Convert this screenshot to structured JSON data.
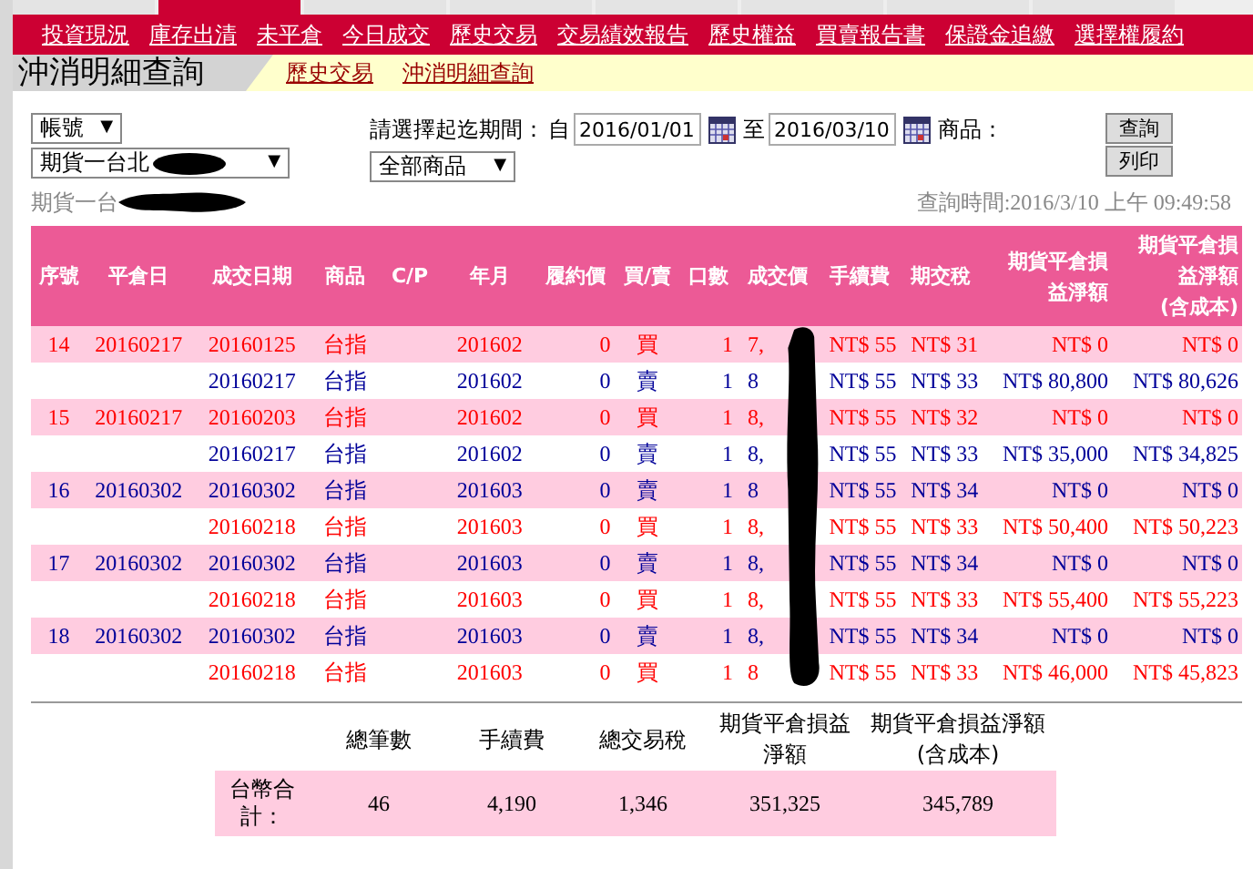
{
  "top_tabs": [
    {
      "selected": false
    },
    {
      "selected": true
    },
    {
      "selected": false
    },
    {
      "selected": false
    },
    {
      "selected": false
    },
    {
      "selected": false
    },
    {
      "selected": false
    },
    {
      "selected": false
    }
  ],
  "select_arrow": "▼",
  "menu": [
    "投資現況",
    "庫存出清",
    "未平倉",
    "今日成交",
    "歷史交易",
    "交易績效報告",
    "歷史權益",
    "買賣報告書",
    "保證金追繳",
    "選擇權履約"
  ],
  "page_title": "沖消明細查詢",
  "breadcrumbs": [
    "歷史交易",
    "沖消明細查詢"
  ],
  "filters": {
    "account_type": "帳號",
    "account": "期貨一台北",
    "period_label": "請選擇起迄期間：",
    "from_label": "自",
    "from": "2016/01/01",
    "to_label": "至",
    "to": "2016/03/10",
    "product_label": "商品：",
    "product": "全部商品",
    "buttons": [
      "查詢",
      "列印"
    ]
  },
  "account_line": "期貨一台",
  "query_time": "查詢時間:2016/3/10 上午 09:49:58",
  "table": {
    "columns": [
      [
        "序號"
      ],
      [
        "平倉日"
      ],
      [
        "成交日期"
      ],
      [
        "商品"
      ],
      [
        "C/P"
      ],
      [
        "年月"
      ],
      [
        "履約價"
      ],
      [
        "買/賣"
      ],
      [
        "口數"
      ],
      [
        "成交價"
      ],
      [
        "手續費"
      ],
      [
        "期交稅"
      ],
      [
        "期貨平倉損",
        "益淨額"
      ],
      [
        "期貨平倉損",
        "益淨額",
        "(含成本)"
      ]
    ],
    "rows": [
      {
        "seq": "14",
        "close_date": "20160217",
        "legs": [
          {
            "kind": "buy",
            "trade_date": "20160125",
            "product": "台指",
            "month": "201602",
            "strike": "0",
            "side": "買",
            "qty": "1",
            "price": "7,",
            "fee": "NT$ 55",
            "tax": "NT$ 31",
            "pl": "NT$ 0",
            "pl_cost": "NT$ 0"
          },
          {
            "kind": "sell",
            "trade_date": "20160217",
            "product": "台指",
            "month": "201602",
            "strike": "0",
            "side": "賣",
            "qty": "1",
            "price": "8",
            "fee": "NT$ 55",
            "tax": "NT$ 33",
            "pl": "NT$ 80,800",
            "pl_cost": "NT$ 80,626"
          }
        ]
      },
      {
        "seq": "15",
        "close_date": "20160217",
        "legs": [
          {
            "kind": "buy",
            "trade_date": "20160203",
            "product": "台指",
            "month": "201602",
            "strike": "0",
            "side": "買",
            "qty": "1",
            "price": "8,",
            "fee": "NT$ 55",
            "tax": "NT$ 32",
            "pl": "NT$ 0",
            "pl_cost": "NT$ 0"
          },
          {
            "kind": "sell",
            "trade_date": "20160217",
            "product": "台指",
            "month": "201602",
            "strike": "0",
            "side": "賣",
            "qty": "1",
            "price": "8,",
            "fee": "NT$ 55",
            "tax": "NT$ 33",
            "pl": "NT$ 35,000",
            "pl_cost": "NT$ 34,825"
          }
        ]
      },
      {
        "seq": "16",
        "close_date": "20160302",
        "legs": [
          {
            "kind": "sell",
            "trade_date": "20160302",
            "product": "台指",
            "month": "201603",
            "strike": "0",
            "side": "賣",
            "qty": "1",
            "price": "8",
            "fee": "NT$ 55",
            "tax": "NT$ 34",
            "pl": "NT$ 0",
            "pl_cost": "NT$ 0"
          },
          {
            "kind": "buy",
            "trade_date": "20160218",
            "product": "台指",
            "month": "201603",
            "strike": "0",
            "side": "買",
            "qty": "1",
            "price": "8,",
            "fee": "NT$ 55",
            "tax": "NT$ 33",
            "pl": "NT$ 50,400",
            "pl_cost": "NT$ 50,223"
          }
        ]
      },
      {
        "seq": "17",
        "close_date": "20160302",
        "legs": [
          {
            "kind": "sell",
            "trade_date": "20160302",
            "product": "台指",
            "month": "201603",
            "strike": "0",
            "side": "賣",
            "qty": "1",
            "price": "8,",
            "fee": "NT$ 55",
            "tax": "NT$ 34",
            "pl": "NT$ 0",
            "pl_cost": "NT$ 0"
          },
          {
            "kind": "buy",
            "trade_date": "20160218",
            "product": "台指",
            "month": "201603",
            "strike": "0",
            "side": "買",
            "qty": "1",
            "price": "8,",
            "fee": "NT$ 55",
            "tax": "NT$ 33",
            "pl": "NT$ 55,400",
            "pl_cost": "NT$ 55,223"
          }
        ]
      },
      {
        "seq": "18",
        "close_date": "20160302",
        "legs": [
          {
            "kind": "sell",
            "trade_date": "20160302",
            "product": "台指",
            "month": "201603",
            "strike": "0",
            "side": "賣",
            "qty": "1",
            "price": "8,",
            "fee": "NT$ 55",
            "tax": "NT$ 34",
            "pl": "NT$ 0",
            "pl_cost": "NT$ 0"
          },
          {
            "kind": "buy",
            "trade_date": "20160218",
            "product": "台指",
            "month": "201603",
            "strike": "0",
            "side": "買",
            "qty": "1",
            "price": "8",
            "fee": "NT$ 55",
            "tax": "NT$ 33",
            "pl": "NT$ 46,000",
            "pl_cost": "NT$ 45,823"
          }
        ]
      }
    ]
  },
  "summary": {
    "columns": [
      [
        "總筆數"
      ],
      [
        "手續費"
      ],
      [
        "總交易稅"
      ],
      [
        "期貨平倉損益",
        "淨額"
      ],
      [
        "期貨平倉損益淨額",
        "(含成本)"
      ]
    ],
    "label": "台幣合計：",
    "values": [
      "46",
      "4,190",
      "1,346",
      "351,325",
      "345,789"
    ]
  }
}
